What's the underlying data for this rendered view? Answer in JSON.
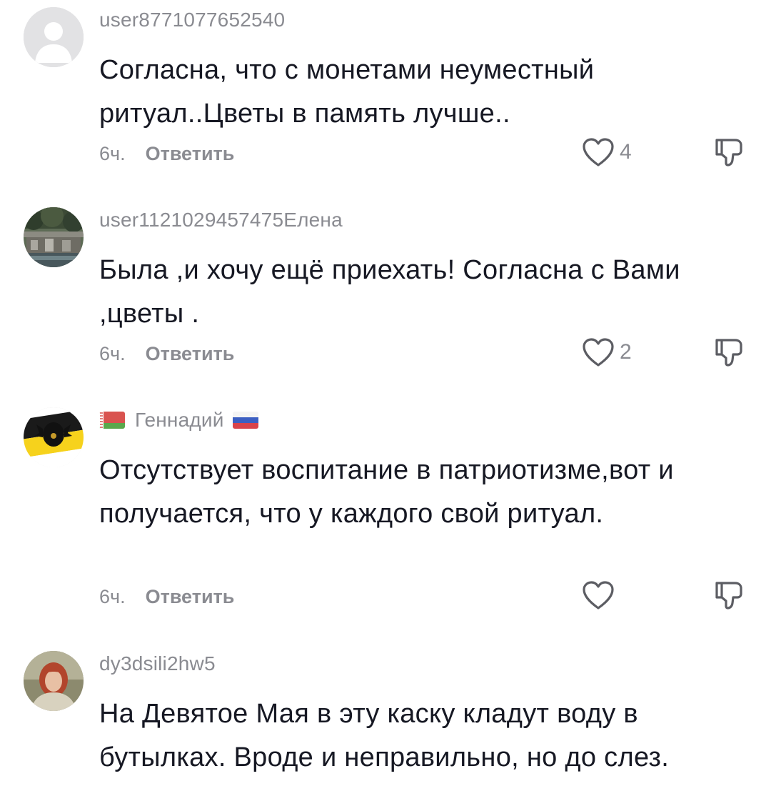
{
  "comments": [
    {
      "username": "user8771077652540",
      "text": "Согласна, что с монетами неуместный ритуал..Цветы в память лучше..",
      "time": "6ч.",
      "reply_label": "Ответить",
      "likes": "4",
      "avatar": "default-avatar"
    },
    {
      "username": "user1121029457475Елена",
      "text": "Была ,и хочу ещё приехать! Согласна с Вами ,цветы .",
      "time": "6ч.",
      "reply_label": "Ответить",
      "likes": "2",
      "avatar": "fountain-photo-avatar"
    },
    {
      "username": "Геннадий",
      "text": "Отсутствует воспитание в патриотизме,вот и получается, что у каждого свой ритуал.",
      "time": "6ч.",
      "reply_label": "Ответить",
      "likes": "",
      "avatar": "imperial-eagle-flag-avatar",
      "flags": [
        "belarus-flag",
        "russia-flag"
      ]
    },
    {
      "username": "dy3dsili2hw5",
      "text": "На Девятое Мая в эту каску кладут воду в бутылках. Вроде и неправильно, но до слез.",
      "avatar": "woman-photo-avatar"
    }
  ],
  "colors": {
    "primary_text": "#161823",
    "secondary_text": "#8a8b91",
    "background": "#ffffff"
  }
}
